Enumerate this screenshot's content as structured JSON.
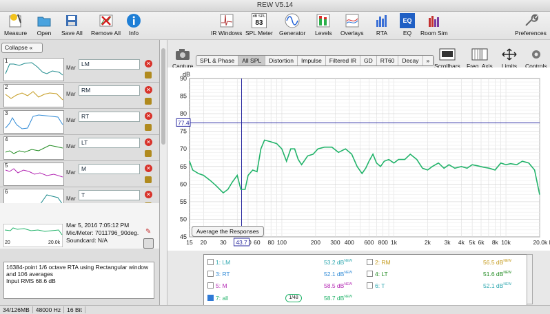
{
  "window_title": "REW V5.14",
  "toolbar": {
    "measure": "Measure",
    "open": "Open",
    "save_all": "Save All",
    "remove_all": "Remove All",
    "info": "Info",
    "ir_windows": "IR Windows",
    "spl_meter": "SPL Meter",
    "spl_meter_badge_top": "dB SPL",
    "spl_meter_badge_value": "83",
    "generator": "Generator",
    "levels": "Levels",
    "overlays": "Overlays",
    "rta": "RTA",
    "eq": "EQ",
    "eq_badge": "EQ",
    "room_sim": "Room Sim",
    "preferences": "Preferences"
  },
  "left_panel": {
    "collapse": "Collapse",
    "collapse_icon": "«",
    "measurements": [
      {
        "num": "1",
        "name": "LM",
        "color": "#1c8a8c",
        "meta": "Mar"
      },
      {
        "num": "2",
        "name": "RM",
        "color": "#c49a1c",
        "meta": "Mar"
      },
      {
        "num": "3",
        "name": "RT",
        "color": "#2f8ad6",
        "meta": "Mar"
      },
      {
        "num": "4",
        "name": "LT",
        "color": "#1f8a1f",
        "meta": "Mar"
      },
      {
        "num": "5",
        "name": "M",
        "color": "#b327b3",
        "meta": "Mar"
      },
      {
        "num": "6",
        "name": "T",
        "color": "#1c8a8c",
        "meta": "Mar"
      },
      {
        "num": "7",
        "name": "all",
        "color": "#22b366",
        "meta": ""
      }
    ],
    "selected_details": {
      "date": "Mar 5, 2016 7:05:12 PM",
      "mic": "Mic/Meter: 7011796_90deg.",
      "soundcard": "Soundcard: N/A",
      "thumb_x_start": "20",
      "thumb_x_end": "20.0k"
    },
    "info_text": [
      "16384-point 1/6 octave RTA using Rectangular window",
      "and 106 averages",
      "Input RMS 68.6 dB"
    ]
  },
  "graph_tabs": [
    "SPL & Phase",
    "All SPL",
    "Distortion",
    "Impulse",
    "Filtered IR",
    "GD",
    "RT60",
    "Decay",
    "»"
  ],
  "active_tab": "All SPL",
  "capture": "Capture",
  "right_tools": {
    "scrollbars": "Scrollbars",
    "freq_axis": "Freq. Axis",
    "limits": "Limits",
    "controls": "Controls"
  },
  "cursor": {
    "y_readout": "77.4",
    "x_readout": "43.7"
  },
  "average_button": "Average the Responses",
  "chart_data": {
    "type": "line",
    "ylabel": "dB",
    "xscale": "log",
    "xlim": [
      15,
      20000
    ],
    "ylim": [
      45,
      90
    ],
    "yticks": [
      "90",
      "85",
      "80",
      "75",
      "70",
      "65",
      "60",
      "55",
      "50",
      "45"
    ],
    "xticks": [
      "15",
      "20",
      "30",
      "40",
      "50",
      "60",
      "80",
      "100",
      "200",
      "300",
      "400",
      "600",
      "800",
      "1k",
      "2k",
      "3k",
      "4k",
      "5k",
      "6k",
      "8k",
      "10k",
      "20.0k Hz"
    ],
    "series": [
      {
        "name": "7: all",
        "color": "#22b36a",
        "x": [
          15,
          16,
          18,
          20,
          23,
          26,
          30,
          33,
          36,
          40,
          43,
          47,
          50,
          55,
          60,
          65,
          70,
          80,
          90,
          100,
          110,
          120,
          130,
          140,
          150,
          170,
          190,
          210,
          240,
          280,
          320,
          370,
          420,
          470,
          520,
          560,
          600,
          650,
          700,
          760,
          820,
          900,
          1000,
          1100,
          1250,
          1400,
          1600,
          1800,
          2000,
          2200,
          2500,
          2800,
          3100,
          3500,
          4000,
          4500,
          5000,
          5600,
          6300,
          7100,
          8000,
          9000,
          10000,
          11000,
          12500,
          14000,
          16000,
          18000,
          20000
        ],
        "y": [
          66.5,
          64,
          63,
          62.5,
          61,
          59.5,
          57.5,
          58.5,
          60.5,
          62.5,
          58.5,
          58.5,
          62.5,
          64,
          63.5,
          70,
          72.5,
          72,
          71.5,
          70,
          66.5,
          70,
          70,
          67,
          65.5,
          68,
          68.5,
          70,
          70.5,
          70.5,
          69,
          70,
          68.5,
          65,
          63,
          64.5,
          66.5,
          68.5,
          66,
          65,
          66.5,
          67,
          66,
          67,
          67,
          68.5,
          67,
          64.5,
          64,
          65,
          66,
          64.5,
          65.5,
          64.5,
          65,
          64.5,
          65.5,
          65.2,
          64.8,
          64.5,
          64,
          66,
          65.5,
          65.8,
          65.5,
          66.5,
          66,
          64,
          57
        ]
      }
    ]
  },
  "legend": [
    {
      "label": "1: LM",
      "value": "53.2 dB",
      "sup": "NEW",
      "color": "#2fa8b0",
      "checked": false
    },
    {
      "label": "2: RM",
      "value": "56.5 dB",
      "sup": "NEW",
      "color": "#c49a1c",
      "checked": false
    },
    {
      "label": "3: RT",
      "value": "52.1 dB",
      "sup": "NEW",
      "color": "#2f8ad6",
      "checked": false
    },
    {
      "label": "4: LT",
      "value": "51.6 dB",
      "sup": "NEW",
      "color": "#1f8a1f",
      "checked": false
    },
    {
      "label": "5: M",
      "value": "58.5 dB",
      "sup": "NEW",
      "color": "#b327b3",
      "checked": false
    },
    {
      "label": "6: T",
      "value": "52.1 dB",
      "sup": "NEW",
      "color": "#2fa8b0",
      "checked": false
    },
    {
      "label": "7: all",
      "value": "58.7 dB",
      "sup": "NEW",
      "color": "#22b36a",
      "checked": true,
      "badge": "1/48"
    }
  ],
  "status": [
    "34/126MB",
    "48000 Hz",
    "16 Bit"
  ]
}
